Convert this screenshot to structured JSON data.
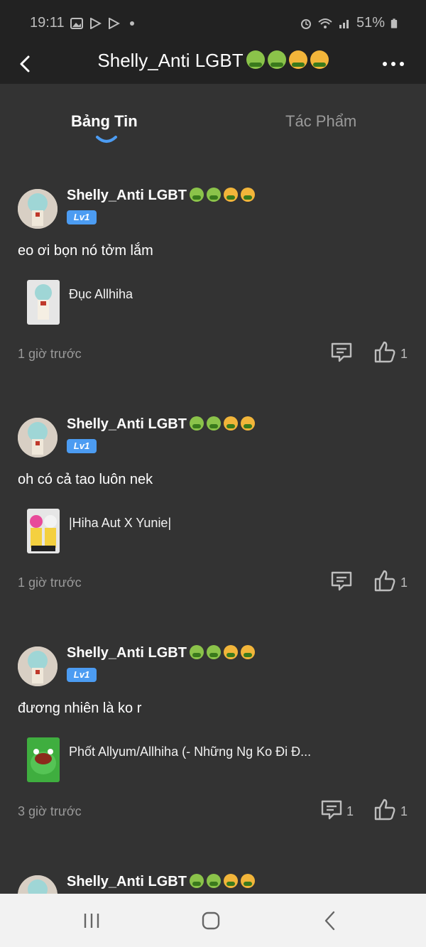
{
  "status_bar": {
    "time": "19:11",
    "battery": "51%"
  },
  "header": {
    "title": "Shelly_Anti LGBT"
  },
  "tabs": [
    {
      "label": "Bảng Tin",
      "active": true
    },
    {
      "label": "Tác Phẩm",
      "active": false
    }
  ],
  "posts": [
    {
      "author": "Shelly_Anti LGBT",
      "level": "Lv1",
      "text": "eo ơi bọn nó tởm lắm",
      "work_title": "Đục Allhiha",
      "time": "1 giờ trước",
      "comments": "",
      "likes": "1"
    },
    {
      "author": "Shelly_Anti LGBT",
      "level": "Lv1",
      "text": "oh có cả tao luôn nek",
      "work_title": "|Hiha Aut X Yunie|",
      "time": "1 giờ trước",
      "comments": "",
      "likes": "1"
    },
    {
      "author": "Shelly_Anti LGBT",
      "level": "Lv1",
      "text": "đương nhiên là ko r",
      "work_title": "Phốt Allyum/Allhiha (- Những Ng Ko Đi Đ...",
      "time": "3 giờ trước",
      "comments": "1",
      "likes": "1"
    },
    {
      "author": "Shelly_Anti LGBT"
    }
  ],
  "colors": {
    "background": "#333333",
    "header": "#222222",
    "accent": "#4c9cf2",
    "nav_bar": "#f2f2f2"
  },
  "icons": [
    "back-arrow-icon",
    "more-options-icon",
    "comment-icon",
    "like-thumb-icon",
    "nav-recents-icon",
    "nav-home-icon",
    "nav-back-icon"
  ]
}
